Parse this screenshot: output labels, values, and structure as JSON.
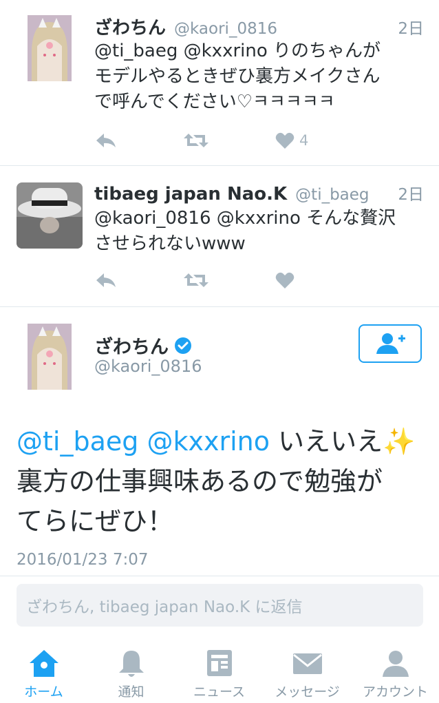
{
  "tweets": [
    {
      "name": "ざわちん",
      "handle": "@kaori_0816",
      "time": "2日",
      "text_lines": [
        "@ti_baeg @kxxrino りのちゃんが",
        "モデルやるときぜひ裏方メイクさん",
        "で呼んでください♡ㅋㅋㅋㅋㅋ"
      ],
      "likes": "4"
    },
    {
      "name": "tibaeg japan Nao.K",
      "handle": "@ti_baeg",
      "time": "2日",
      "text_lines": [
        "@kaori_0816 @kxxrino そんな贅沢",
        "させられないwww"
      ],
      "likes": ""
    }
  ],
  "main_tweet": {
    "name": "ざわちん",
    "handle": "@kaori_0816",
    "mention1": "@ti_baeg",
    "mention2": "@kxxrino",
    "line1_text": "いえいえ",
    "sparkle": "✨",
    "line2": "裏方の仕事興味あるので勉強が",
    "line3": "てらにぜひ！",
    "timestamp": "2016/01/23 7:07"
  },
  "reply_placeholder": "ざわちん, tibaeg japan Nao.K に返信",
  "tabs": [
    {
      "label": "ホーム",
      "icon": "home-icon"
    },
    {
      "label": "通知",
      "icon": "bell-icon"
    },
    {
      "label": "ニュース",
      "icon": "news-icon"
    },
    {
      "label": "メッセージ",
      "icon": "envelope-icon"
    },
    {
      "label": "アカウント",
      "icon": "person-icon"
    }
  ],
  "colors": {
    "accent": "#1da1f2",
    "muted": "#8899a6",
    "icon_gray": "#aab8c2",
    "text": "#292f33",
    "verified": "#1da1f2"
  }
}
